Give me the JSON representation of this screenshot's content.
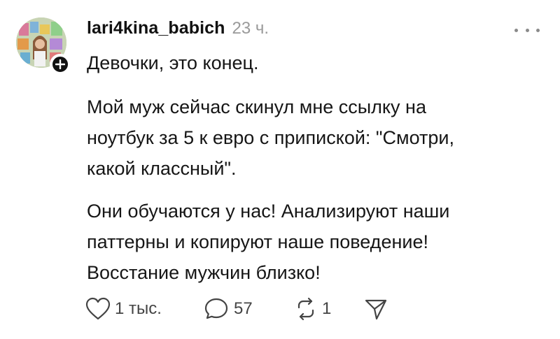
{
  "post": {
    "username": "lari4kina_babich",
    "time": "23 ч.",
    "paragraphs": [
      "Девочки, это конец.",
      "Мой муж сейчас скинул мне ссылку на\nноутбук за 5 к евро с припиской: \"Смотри,\nкакой классный\".",
      "Они обучаются у нас! Анализируют наши\nпаттерны и копируют наше поведение!\nВосстание мужчин близко!"
    ],
    "actions": {
      "likes": "1 тыс.",
      "comments": "57",
      "reposts": "1"
    }
  },
  "icons": {
    "avatar": "avatar-image",
    "follow": "plus-icon",
    "more": "more-dots-icon",
    "like": "heart-icon",
    "comment": "comment-bubble-icon",
    "repost": "repost-icon",
    "share": "send-icon"
  },
  "colors": {
    "text": "#161616",
    "muted": "#9a9a9a",
    "icon": "#444444",
    "badge": "#111111"
  }
}
